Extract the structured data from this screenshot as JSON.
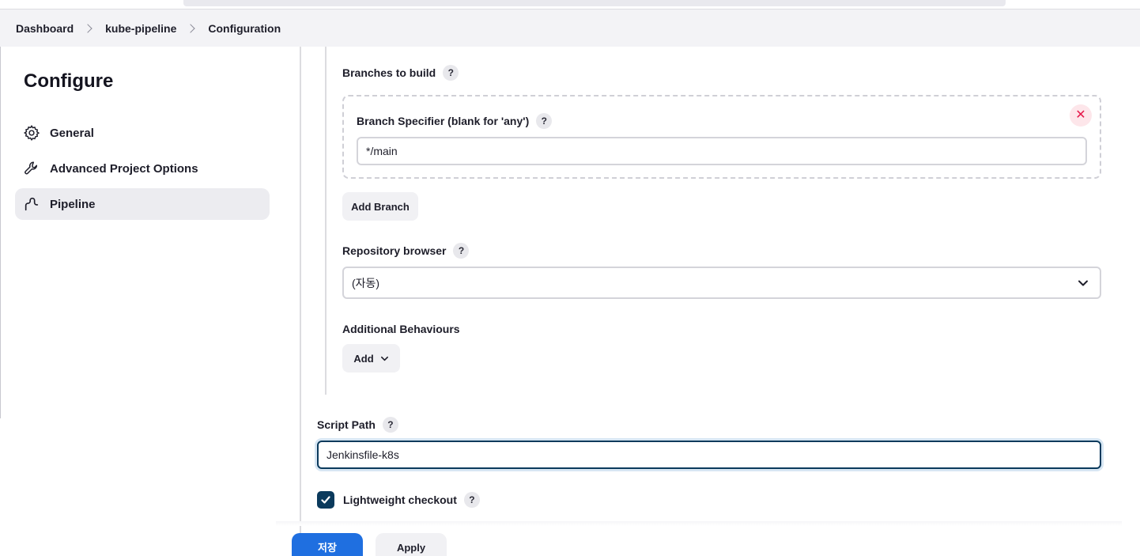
{
  "breadcrumb": {
    "items": [
      "Dashboard",
      "kube-pipeline",
      "Configuration"
    ]
  },
  "sidebar": {
    "title": "Configure",
    "items": [
      {
        "label": "General",
        "icon": "gear-icon",
        "active": false
      },
      {
        "label": "Advanced Project Options",
        "icon": "wrench-icon",
        "active": false
      },
      {
        "label": "Pipeline",
        "icon": "pipeline-icon",
        "active": true
      }
    ]
  },
  "scm": {
    "branches_label": "Branches to build",
    "branch_specifier_label": "Branch Specifier (blank for 'any')",
    "branch_specifier_value": "*/main",
    "add_branch_label": "Add Branch",
    "repo_browser_label": "Repository browser",
    "repo_browser_value": "(자동)",
    "additional_behaviours_label": "Additional Behaviours",
    "add_label": "Add"
  },
  "script": {
    "path_label": "Script Path",
    "path_value": "Jenkinsfile-k8s",
    "lightweight_label": "Lightweight checkout",
    "lightweight_checked": true
  },
  "help_glyph": "?",
  "close_glyph": "✕",
  "footer": {
    "save_label": "저장",
    "apply_label": "Apply"
  },
  "colors": {
    "primary": "#1f6fe0",
    "checkbox": "#0b3a5c",
    "focus_border": "#0b3a5c",
    "danger": "#e6194b"
  }
}
